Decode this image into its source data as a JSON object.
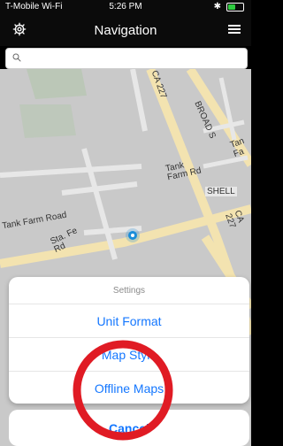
{
  "status_bar": {
    "carrier": "T-Mobile Wi-Fi",
    "time": "5:26 PM"
  },
  "navbar": {
    "title": "Navigation"
  },
  "map": {
    "labels": {
      "ca227_top": "CA 227",
      "broad": "BROAD S",
      "tank_farm_rd_right": "Tank Farm Rd",
      "shell": "SHELL",
      "tank_farm_road": "Tank Farm Road",
      "santa_fe_rd": "Sta. Fe Rd",
      "ca227_bottom": "CA 227",
      "tan_fa": "Tan Fa"
    }
  },
  "action_sheet": {
    "title": "Settings",
    "items": [
      "Unit Format",
      "Map Style",
      "Offline Maps"
    ],
    "cancel": "Cancel"
  },
  "colors": {
    "accent": "#1477ff",
    "highlight_circle": "#e01b24"
  }
}
